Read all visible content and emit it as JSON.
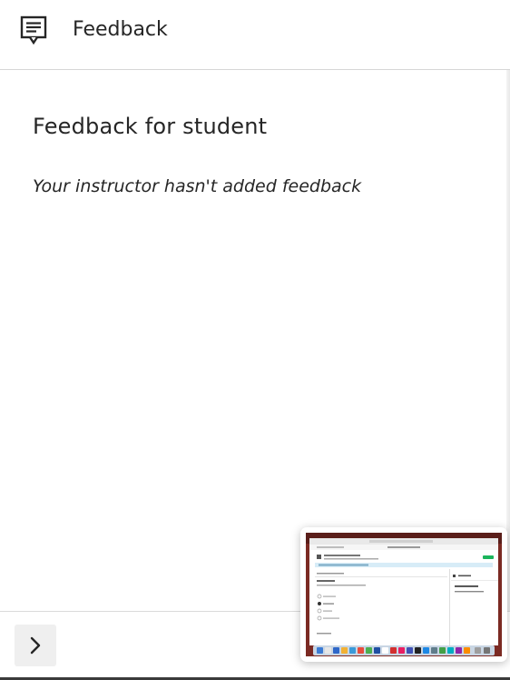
{
  "header": {
    "icon": "feedback-icon",
    "title": "Feedback"
  },
  "feedback": {
    "section_title": "Feedback for student",
    "empty_message": "Your instructor hasn't added feedback"
  },
  "footer": {
    "expand_icon": "chevron-right-icon"
  },
  "thumbnail": {
    "label": "screenshot-preview"
  },
  "colors": {
    "text": "#262626",
    "divider": "#d6d6d6",
    "button_bg": "#efefef",
    "thumbnail_accent": "#1bb55c"
  }
}
